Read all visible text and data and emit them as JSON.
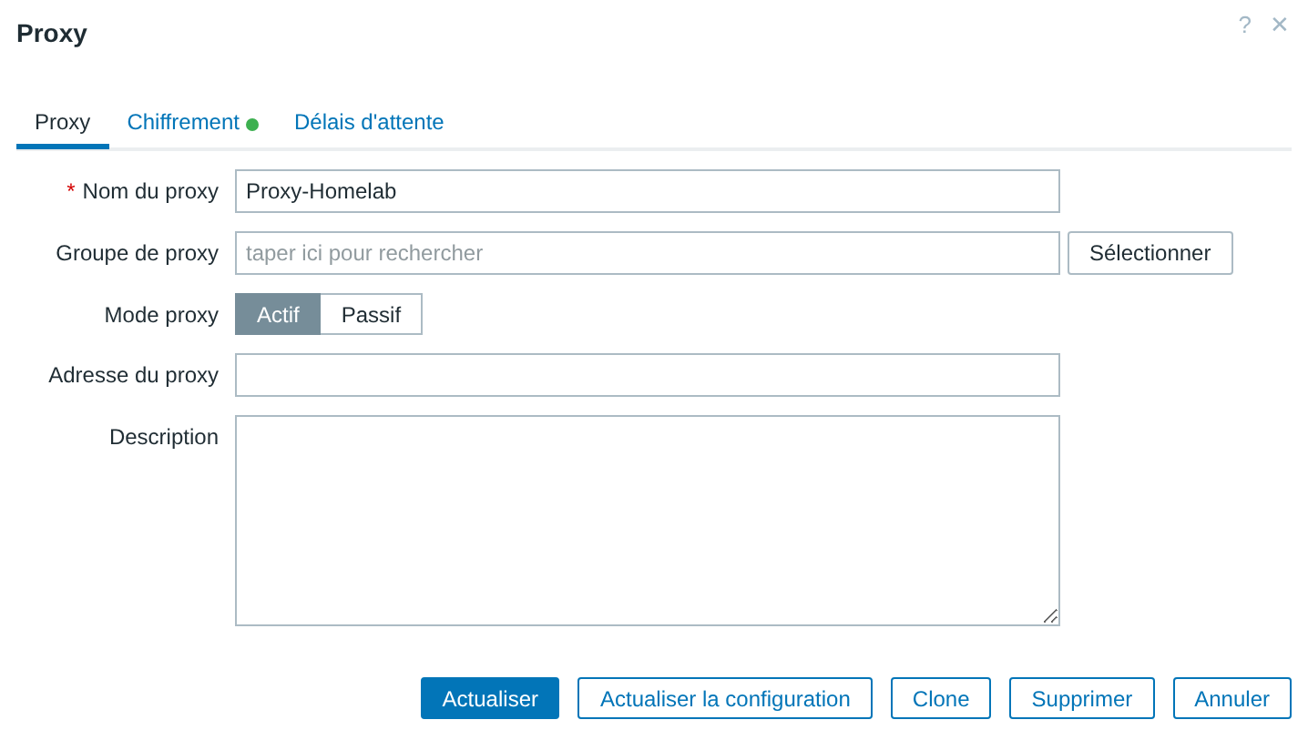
{
  "dialog": {
    "title": "Proxy",
    "help_icon": "?",
    "close_icon": "✕"
  },
  "tabs": [
    {
      "label": "Proxy",
      "selected": true,
      "indicator": false
    },
    {
      "label": "Chiffrement",
      "selected": false,
      "indicator": true
    },
    {
      "label": "Délais d'attente",
      "selected": false,
      "indicator": false
    }
  ],
  "form": [
    {
      "kind": "text",
      "label": "Nom du proxy",
      "required_mark": "*",
      "value": "Proxy-Homelab"
    },
    {
      "kind": "picker",
      "label": "Groupe de proxy",
      "placeholder": "taper ici pour rechercher",
      "button": "Sélectionner"
    },
    {
      "kind": "segmented",
      "label": "Mode proxy",
      "options": [
        {
          "label": "Actif",
          "selected": true
        },
        {
          "label": "Passif",
          "selected": false
        }
      ]
    },
    {
      "kind": "text",
      "label": "Adresse du proxy"
    },
    {
      "kind": "textarea",
      "label": "Description"
    }
  ],
  "buttons": [
    {
      "label": "Actualiser",
      "kind": "primary"
    },
    {
      "label": "Actualiser la configuration",
      "kind": "secondary"
    },
    {
      "label": "Clone",
      "kind": "secondary"
    },
    {
      "label": "Supprimer",
      "kind": "secondary"
    },
    {
      "label": "Annuler",
      "kind": "secondary"
    }
  ]
}
